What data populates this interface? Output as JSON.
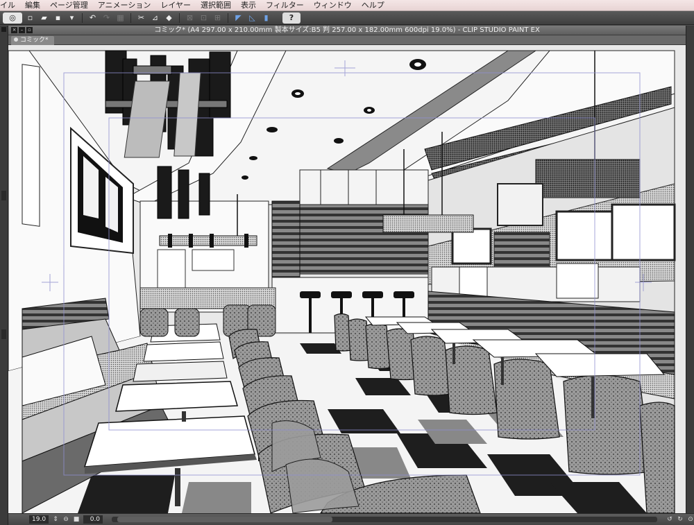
{
  "menubar": {
    "items": [
      "イル",
      "編集",
      "ページ管理",
      "アニメーション",
      "レイヤー",
      "選択範囲",
      "表示",
      "フィルター",
      "ウィンドウ",
      "ヘルプ"
    ]
  },
  "toolbar": {
    "help_label": "?"
  },
  "window": {
    "title": "コミック* (A4 297.00 x 210.00mm 製本サイズ:B5 判 257.00 x 182.00mm 600dpi 19.0%)  - CLIP STUDIO PAINT EX",
    "tab_label": "コミック*"
  },
  "statusbar": {
    "zoom": "19.0",
    "angle": "0.0"
  },
  "colors": {
    "menubar_bg": "#f0e0e0",
    "toolbar_bg": "#4a4a4a",
    "canvas_bg": "#e9e9e9",
    "guide_color": "#8e8ecf"
  }
}
